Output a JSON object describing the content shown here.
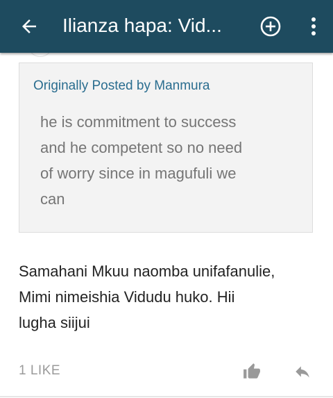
{
  "appbar": {
    "title": "Ilianza hapa: Vid...",
    "background": "#1e4b5f",
    "back_icon": "arrow-back-icon",
    "add_icon": "add-circle-icon",
    "more_icon": "more-vert-icon"
  },
  "post": {
    "quote": {
      "attribution": "Originally Posted by Manmura",
      "lines": [
        "he is commitment to success",
        "and he competent so no need",
        "of worry since in magufuli we",
        "can"
      ]
    },
    "body_lines": [
      "Samahani Mkuu naomba unifafanulie,",
      "Mimi nimeishia Vidudu huko. Hii",
      "lugha siijui"
    ],
    "like_count": "1 LIKE",
    "like_icon": "thumbs-up-icon",
    "reply_icon": "reply-icon",
    "link_color": "#2a6d8f"
  }
}
